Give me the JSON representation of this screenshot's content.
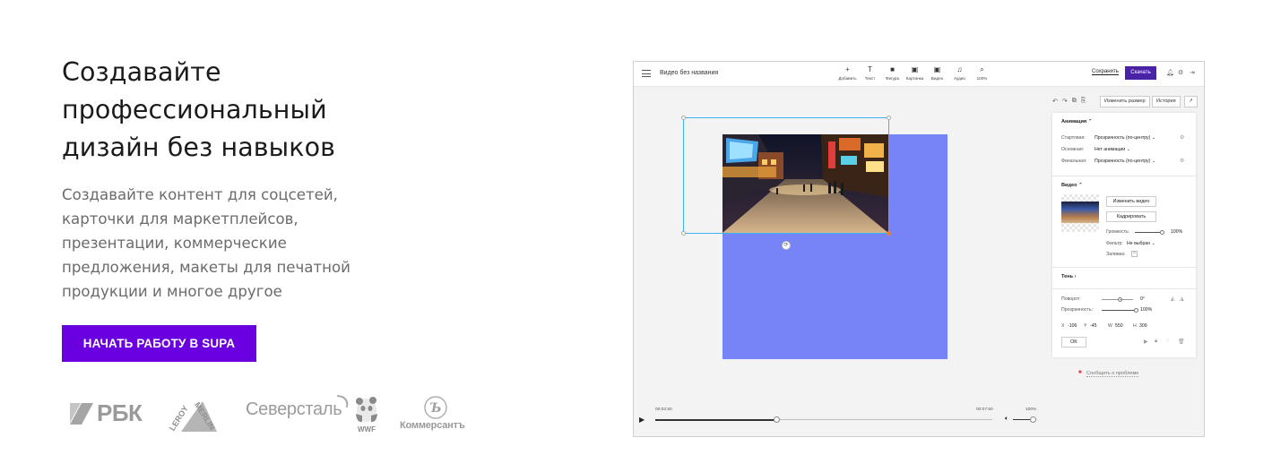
{
  "hero": {
    "title_lines": [
      "Создавайте",
      "профессиональный",
      "дизайн без навыков"
    ],
    "subtitle_lines": [
      "Создавайте контент для соцсетей,",
      "карточки для маркетплейсов,",
      "презентации, коммерческие",
      "предложения, макеты для печатной",
      "продукции и многое другое"
    ],
    "cta_label": "НАЧАТЬ РАБОТУ В SUPA",
    "cta_color": "#6a00e0"
  },
  "logos": {
    "rbk": "РБК",
    "leroy_top": "LEROY",
    "leroy_bottom": "MERLIN",
    "severstal": "Северсталь",
    "wwf": "WWF",
    "kommersant": "Коммерсантъ"
  },
  "editor": {
    "doc_title": "Видео без названия",
    "tools": [
      {
        "icon": "+",
        "label": "Добавить"
      },
      {
        "icon": "T",
        "label": "Текст"
      },
      {
        "icon": "■",
        "label": "Фигура"
      },
      {
        "icon": "▣",
        "label": "Картинка"
      },
      {
        "icon": "▣",
        "label": "Видео"
      },
      {
        "icon": "♫",
        "label": "Аудио"
      },
      {
        "icon": "⌕",
        "label": "100%"
      }
    ],
    "save_label": "Сохранить",
    "download_label": "Скачать",
    "download_color": "#4a22a8",
    "canvas_color": "#7784f8",
    "resize_label": "Изменить размер",
    "history_label": "История",
    "panel": {
      "animation_header": "Анимация",
      "start_label": "Стартовая:",
      "start_value": "Прозрачность (по-центру)",
      "main_label": "Основная:",
      "main_value": "Нет анимации",
      "final_label": "Финальная:",
      "final_value": "Прозрачность (по-центру)",
      "video_header": "Видео",
      "change_video": "Изменить видео",
      "crop": "Кадрировать",
      "volume_label": "Громкость:",
      "volume_value": "100%",
      "volume_level": 1.0,
      "filter_label": "Фильтр:",
      "filter_value": "Не выбран",
      "fill_label": "Заливка:",
      "shadow_header": "Тень",
      "rotation_label": "Поворот:",
      "rotation_value": "0°",
      "opacity_label": "Прозрачность:",
      "opacity_value": "100%",
      "x_label": "X",
      "x_value": "-106",
      "y_label": "Y",
      "y_value": "-45",
      "w_label": "W",
      "w_value": "550",
      "h_label": "H",
      "h_value": "309",
      "ok_label": "OK"
    },
    "report_label": "Сообщить о проблеме",
    "timeline": {
      "current_time": "00:02:50",
      "total_time": "00:07:50",
      "volume_value": "100%",
      "progress": 0.36
    }
  }
}
